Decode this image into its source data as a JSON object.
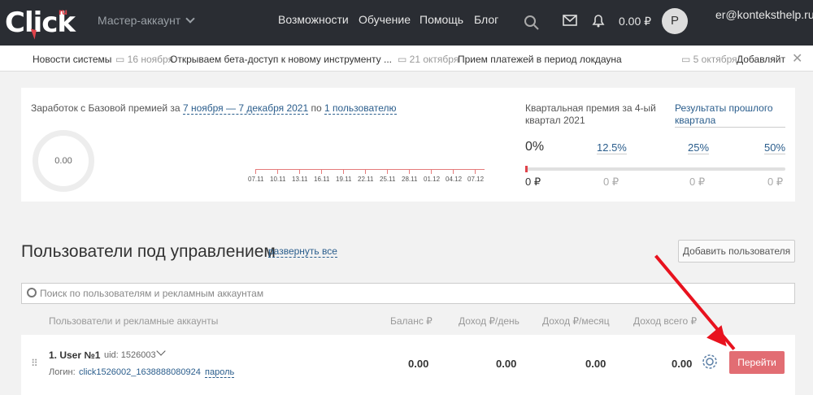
{
  "header": {
    "logo": "Click",
    "logo_sup": "ru",
    "account": "Мастер-аккаунт",
    "nav": [
      "Возможности",
      "Обучение",
      "Помощь",
      "Блог"
    ],
    "balance": "0.00 ₽",
    "avatar": "P",
    "email": "er@konteksthelp.ru"
  },
  "news": {
    "label": "Новости системы",
    "items": [
      {
        "date": "16 ноября",
        "text": "Открываем бета-доступ к новому инструменту ..."
      },
      {
        "date": "21 октября",
        "text": "Прием платежей в период локдауна"
      },
      {
        "date": "5 октября",
        "text": "Добавляйт"
      }
    ]
  },
  "earnings": {
    "prefix": "Заработок с Базовой премией за",
    "period": "7 ноября — 7 декабря 2021",
    "by": "по",
    "users": "1 пользователю",
    "donut_value": "0.00",
    "dates": [
      "07.11",
      "10.11",
      "13.11",
      "16.11",
      "19.11",
      "22.11",
      "25.11",
      "28.11",
      "01.12",
      "04.12",
      "07.12"
    ]
  },
  "quarter": {
    "title": "Квартальная премия за 4-ый квартал 2021",
    "results_link": "Результаты прошлого квартала",
    "levels": [
      "0%",
      "12.5%",
      "25%",
      "50%"
    ],
    "amounts": [
      "0 ₽",
      "0 ₽",
      "0 ₽",
      "0 ₽"
    ]
  },
  "users": {
    "title": "Пользователи под управлением",
    "expand": "развернуть все",
    "add_button": "Добавить пользователя",
    "search_placeholder": "Поиск по пользователям и рекламным аккаунтам"
  },
  "table": {
    "headers": [
      "Пользователи и рекламные аккаунты",
      "Баланс ₽",
      "Доход ₽/день",
      "Доход ₽/месяц",
      "Доход всего ₽"
    ],
    "row": {
      "name": "1. User №1",
      "uid": "uid: 1526003",
      "login_label": "Логин:",
      "login": "click1526002_1638888080924",
      "password": "пароль",
      "values": [
        "0.00",
        "0.00",
        "0.00",
        "0.00"
      ],
      "go": "Перейти"
    }
  }
}
